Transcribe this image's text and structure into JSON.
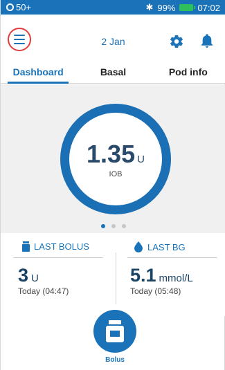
{
  "status_bar": {
    "left_text": "50+",
    "battery_percent": "99%",
    "time": "07:02",
    "icons": [
      "pod-ring-icon",
      "bluetooth-icon",
      "battery-icon"
    ]
  },
  "top_bar": {
    "menu_icon": "hamburger-menu-icon",
    "date": "2 Jan",
    "settings_icon": "gear-icon",
    "notifications_icon": "bell-icon"
  },
  "tabs": [
    {
      "label": "Dashboard",
      "active": true
    },
    {
      "label": "Basal",
      "active": false
    },
    {
      "label": "Pod info",
      "active": false
    }
  ],
  "iob": {
    "value": "1.35",
    "unit": "U",
    "label": "IOB"
  },
  "pager": {
    "count": 3,
    "active_index": 0
  },
  "last_bolus": {
    "title": "LAST BOLUS",
    "value": "3",
    "unit": "U",
    "time": "Today (04:47)",
    "icon": "insulin-vial-icon"
  },
  "last_bg": {
    "title": "LAST BG",
    "value": "5.1",
    "unit": "mmol/L",
    "time": "Today (05:48)",
    "icon": "blood-drop-icon"
  },
  "bolus_button": {
    "label": "Bolus",
    "icon": "insulin-vial-icon"
  },
  "colors": {
    "accent": "#1a73b8",
    "ring": "#1b6fb5",
    "highlight_circle": "#e23b3b",
    "battery": "#2ec05a"
  }
}
